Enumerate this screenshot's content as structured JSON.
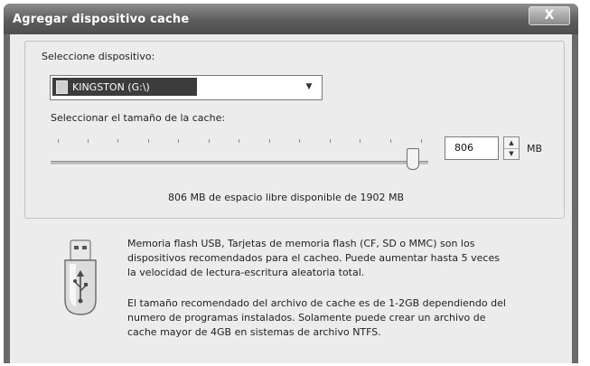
{
  "window": {
    "title": "Agregar dispositivo cache",
    "close_glyph": "X"
  },
  "group": {
    "legend": "Seleccione dispositivo:"
  },
  "device": {
    "selected": "KINGSTON (G:\\)",
    "icon": "drive-icon"
  },
  "cache_size": {
    "label": "Seleccionar el tamaño de la cache:",
    "value": "806",
    "unit": "MB",
    "slider_position": 0.96,
    "free_space_text": "806 MB de espacio libre disponible de 1902 MB"
  },
  "info": {
    "icon": "usb-drive-icon",
    "paragraph1": [
      "Memoria flash USB, Tarjetas de memoria flash (CF, SD o MMC) son los",
      "dispositivos recomendados para el cacheo. Puede aumentar hasta 5 veces",
      "la velocidad de lectura-escritura aleatoria total."
    ],
    "paragraph2": [
      "El tamaño recomendado del archivo de cache es de 1-2GB dependiendo del",
      "numero de programas instalados. Solamente puede crear un archivo de",
      "cache mayor de 4GB en sistemas de archivo NTFS."
    ]
  }
}
